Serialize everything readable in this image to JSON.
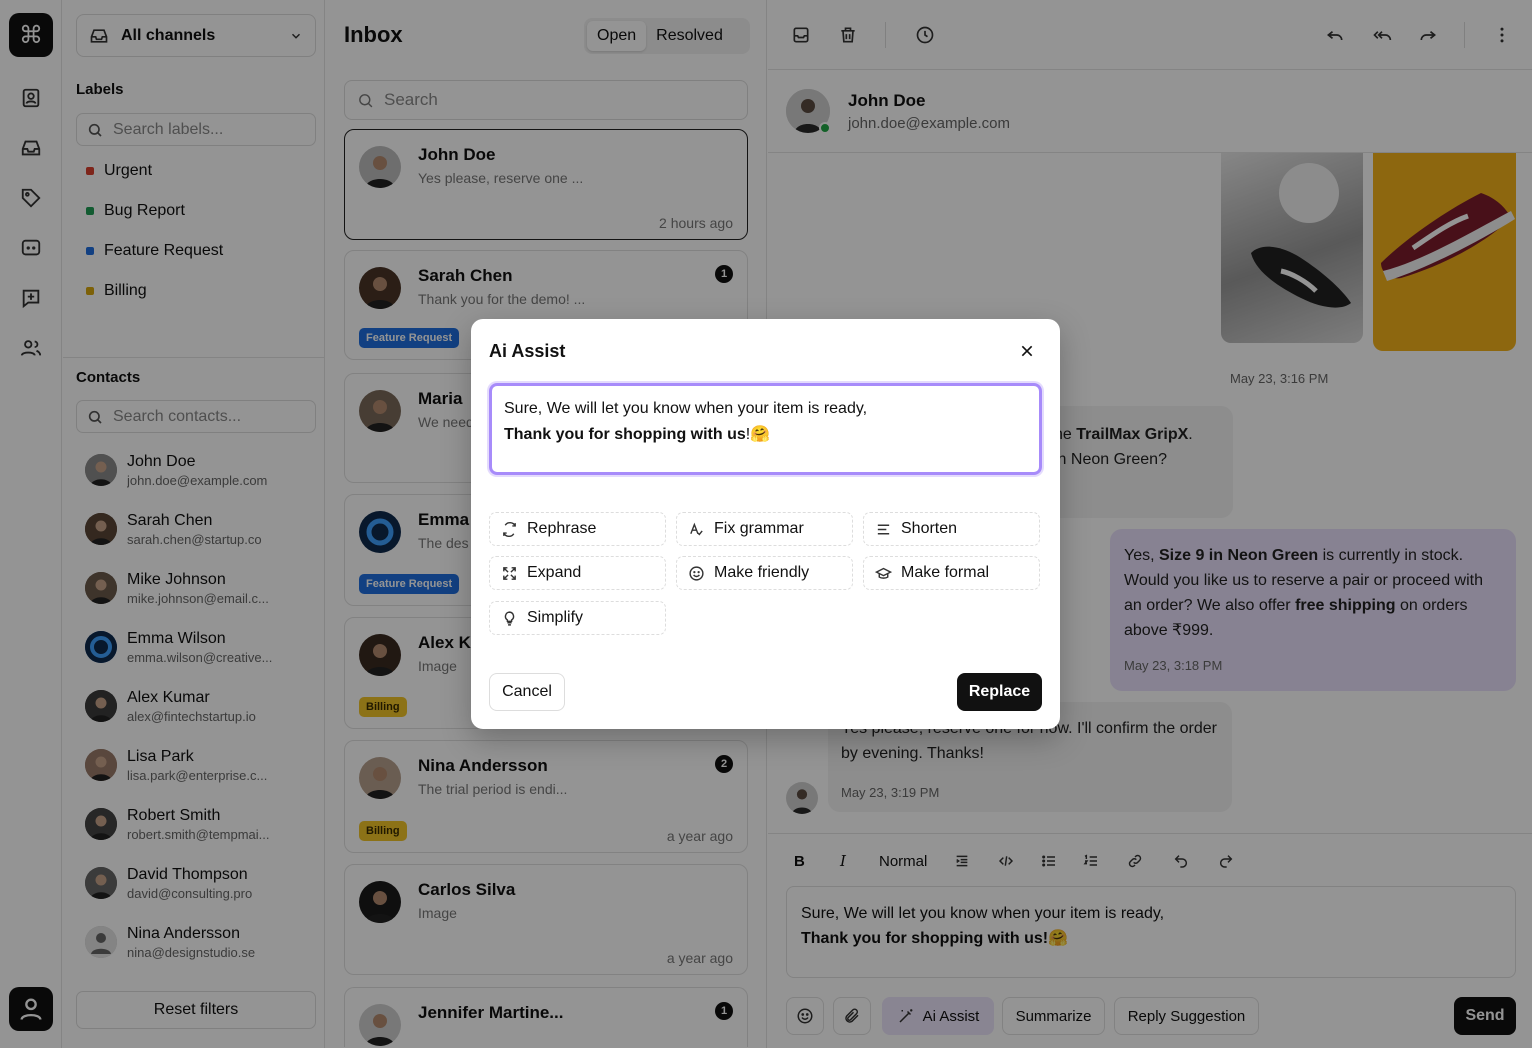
{
  "sidebar": {
    "channel_select": "All channels",
    "labels_title": "Labels",
    "labels_search_placeholder": "Search labels...",
    "labels": [
      {
        "name": "Urgent",
        "color": "#d9412f"
      },
      {
        "name": "Bug Report",
        "color": "#1f9d55"
      },
      {
        "name": "Feature Request",
        "color": "#1f6fe0"
      },
      {
        "name": "Billing",
        "color": "#d8a70f"
      }
    ],
    "contacts_title": "Contacts",
    "contacts_search_placeholder": "Search contacts...",
    "contacts": [
      {
        "name": "John Doe",
        "email": "john.doe@example.com"
      },
      {
        "name": "Sarah Chen",
        "email": "sarah.chen@startup.co"
      },
      {
        "name": "Mike Johnson",
        "email": "mike.johnson@email.c..."
      },
      {
        "name": "Emma Wilson",
        "email": "emma.wilson@creative..."
      },
      {
        "name": "Alex Kumar",
        "email": "alex@fintechstartup.io"
      },
      {
        "name": "Lisa Park",
        "email": "lisa.park@enterprise.c..."
      },
      {
        "name": "Robert Smith",
        "email": "robert.smith@tempmai..."
      },
      {
        "name": "David Thompson",
        "email": "david@consulting.pro"
      },
      {
        "name": "Nina Andersson",
        "email": "nina@designstudio.se"
      }
    ],
    "reset_label": "Reset filters"
  },
  "inbox": {
    "title": "Inbox",
    "tabs": [
      "Open",
      "Resolved"
    ],
    "search_placeholder": "Search",
    "conversations": [
      {
        "name": "John Doe",
        "preview": "Yes please, reserve one ...",
        "time": "2 hours ago",
        "badge": "",
        "tag": ""
      },
      {
        "name": "Sarah Chen",
        "preview": "Thank you for the demo! ...",
        "time": "",
        "badge": "1",
        "tag": "Feature Request"
      },
      {
        "name": "Maria",
        "preview": "We need",
        "time": "",
        "badge": "",
        "tag": ""
      },
      {
        "name": "Emma",
        "preview": "The des",
        "time": "",
        "badge": "",
        "tag": "Feature Request"
      },
      {
        "name": "Alex K",
        "preview": "Image",
        "time": "",
        "badge": "",
        "tag": "Billing"
      },
      {
        "name": "Nina Andersson",
        "preview": "The trial period is endi...",
        "time": "a year ago",
        "badge": "2",
        "tag": "Billing"
      },
      {
        "name": "Carlos Silva",
        "preview": "Image",
        "time": "a year ago",
        "badge": "",
        "tag": ""
      },
      {
        "name": "Jennifer Martine...",
        "preview": "",
        "time": "",
        "badge": "1",
        "tag": ""
      }
    ]
  },
  "conversation": {
    "contact_name": "John Doe",
    "contact_email": "john.doe@example.com",
    "image_stamp": "May 23, 3:16 PM",
    "msg1": {
      "line1_pre": "he ",
      "line1_bold": "TrailMax GripX",
      "line1_post": ".",
      "line2": "in Neon Green?"
    },
    "msg2": {
      "p1": "Yes, ",
      "b1": "Size 9 in Neon Green",
      "p2": " is currently in stock. Would you like us to reserve a pair or proceed with an order? We also offer ",
      "b2": "free shipping",
      "p3": " on orders above ₹999.",
      "time": "May 23, 3:18 PM"
    },
    "msg3": {
      "text": "Yes please, reserve one for now. I'll confirm the order by evening. Thanks!",
      "time": "May 23, 3:19 PM"
    }
  },
  "composer": {
    "format_label": "Normal",
    "line1": "Sure, We will let you know when your item is ready,",
    "line2": "Thank you for shopping with us!",
    "emoji": "🤗",
    "buttons": {
      "ai": "Ai Assist",
      "summarize": "Summarize",
      "reply": "Reply Suggestion",
      "send": "Send"
    }
  },
  "modal": {
    "title": "Ai Assist",
    "line1": "Sure, We will let you know when your item is ready,",
    "line2": "Thank you for shopping with us",
    "line2_suffix": "!",
    "emoji": "🤗",
    "options": [
      {
        "label": "Rephrase",
        "icon": "refresh-icon"
      },
      {
        "label": "Fix grammar",
        "icon": "spell-check-icon"
      },
      {
        "label": "Shorten",
        "icon": "align-left-icon"
      },
      {
        "label": "Expand",
        "icon": "expand-icon"
      },
      {
        "label": "Make friendly",
        "icon": "smile-icon"
      },
      {
        "label": "Make formal",
        "icon": "graduation-cap-icon"
      },
      {
        "label": "Simplify",
        "icon": "lightbulb-icon"
      }
    ],
    "cancel": "Cancel",
    "replace": "Replace"
  },
  "colors": {
    "accent": "#a78bfa",
    "outgoing_bubble": "#e9e1fb",
    "primary_button": "#111111",
    "feature_tag": "#1f6fe0",
    "billing_tag": "#f2c428"
  }
}
